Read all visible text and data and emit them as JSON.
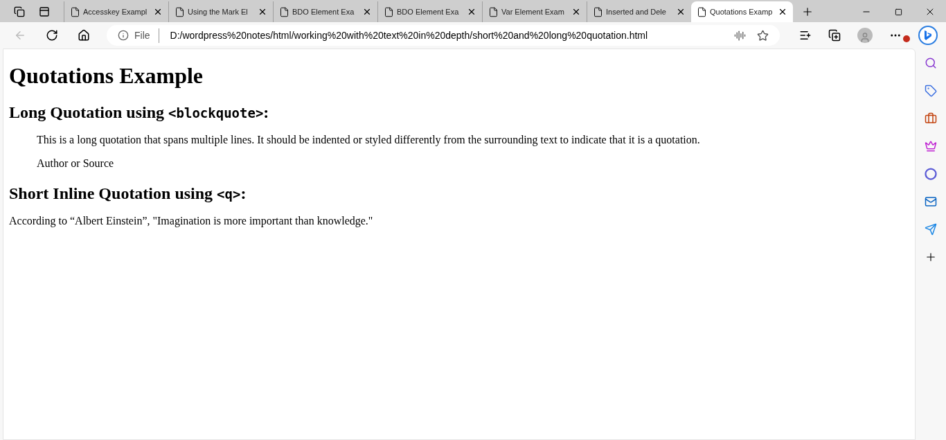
{
  "tabs": [
    {
      "title": "Accesskey Exampl",
      "selected": false
    },
    {
      "title": "Using the Mark El",
      "selected": false
    },
    {
      "title": "BDO Element Exa",
      "selected": false
    },
    {
      "title": "BDO Element Exa",
      "selected": false
    },
    {
      "title": "Var Element Exam",
      "selected": false
    },
    {
      "title": "Inserted and Dele",
      "selected": false
    },
    {
      "title": "Quotations Examp",
      "selected": true
    }
  ],
  "address": {
    "scheme": "File",
    "url": "D:/wordpress%20notes/html/working%20with%20text%20in%20depth/short%20and%20long%20quotation.html"
  },
  "page": {
    "title": "Quotations Example",
    "sections": [
      {
        "heading": {
          "text": "Long Quotation using ",
          "code": "<blockquote>",
          "suffix": ":"
        },
        "kind": "blockquote",
        "paragraphs": [
          "This is a long quotation that spans multiple lines. It should be indented or styled differently from the surrounding text to indicate that it is a quotation.",
          "Author or Source"
        ]
      },
      {
        "heading": {
          "text": "Short Inline Quotation using ",
          "code": "<q>",
          "suffix": ":"
        },
        "kind": "paragraph",
        "paragraphs": [
          "According to “Albert Einstein”, \"Imagination is more important than knowledge.\""
        ]
      }
    ]
  }
}
